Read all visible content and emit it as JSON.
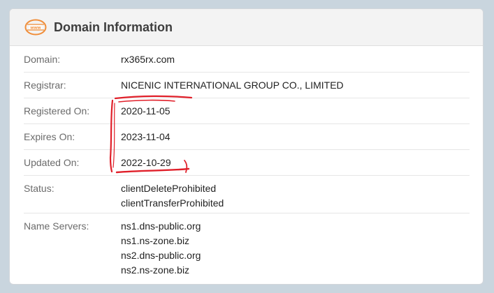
{
  "panel": {
    "title": "Domain Information",
    "icon": "www-globe-icon",
    "icon_text": "www",
    "accent": "#f08e3a"
  },
  "rows": {
    "domain": {
      "label": "Domain:",
      "value": "rx365rx.com"
    },
    "registrar": {
      "label": "Registrar:",
      "value": "NICENIC INTERNATIONAL GROUP CO., LIMITED"
    },
    "registered_on": {
      "label": "Registered On:",
      "value": "2020-11-05"
    },
    "expires_on": {
      "label": "Expires On:",
      "value": "2023-11-04"
    },
    "updated_on": {
      "label": "Updated On:",
      "value": "2022-10-29"
    },
    "status": {
      "label": "Status:",
      "values": [
        "clientDeleteProhibited",
        "clientTransferProhibited"
      ]
    },
    "name_servers": {
      "label": "Name Servers:",
      "values": [
        "ns1.dns-public.org",
        "ns1.ns-zone.biz",
        "ns2.dns-public.org",
        "ns2.ns-zone.biz"
      ]
    }
  },
  "annotation": {
    "color": "#e0202a",
    "shape": "hand-drawn bracket around dates"
  }
}
